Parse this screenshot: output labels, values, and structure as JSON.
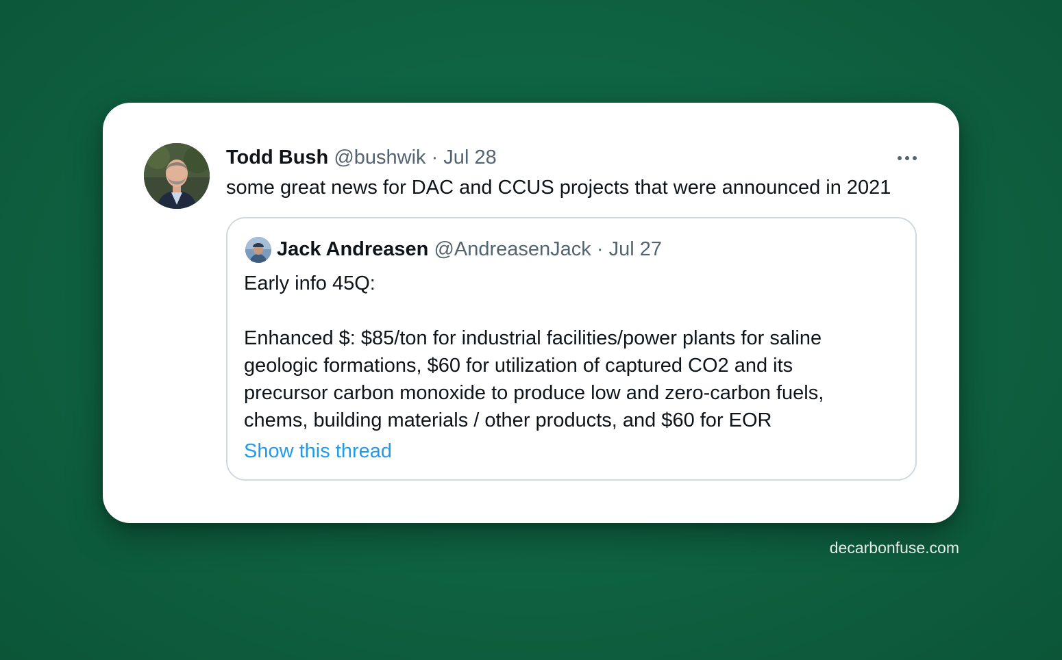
{
  "tweet": {
    "author_name": "Todd Bush",
    "author_meta": "@bushwik · Jul 28",
    "text": "some great news for DAC and CCUS projects that were announced in 2021",
    "more_icon": "more-horizontal-icon"
  },
  "quoted_tweet": {
    "author_name": "Jack Andreasen",
    "author_meta": "@AndreasenJack · Jul 27",
    "lines": [
      "Early info 45Q:",
      "Enhanced $: $85/ton for industrial facilities/power plants for saline",
      "geologic formations, $60 for utilization of captured CO2 and its",
      "precursor carbon monoxide to produce low and zero-carbon fuels,",
      "chems, building materials / other products, and $60 for EOR"
    ],
    "show_thread_label": "Show this thread"
  },
  "watermark": "decarbonfuse.com",
  "colors": {
    "background": "#0f6443",
    "card": "#ffffff",
    "text_primary": "#0f1419",
    "text_secondary": "#536471",
    "link": "#1d9bf0",
    "border": "#cfd9de"
  }
}
